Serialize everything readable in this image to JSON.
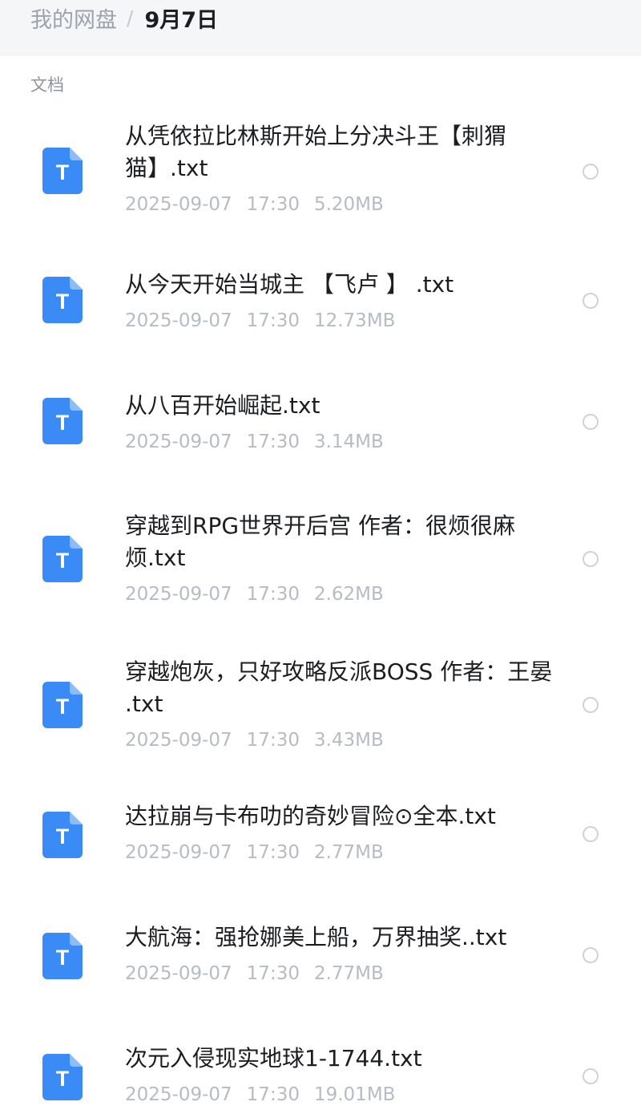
{
  "breadcrumb": {
    "root": "我的网盘",
    "separator": "/",
    "current": "9月7日"
  },
  "section": {
    "label": "文档"
  },
  "file_icon": {
    "glyph": "T",
    "color": "#3a8bf5",
    "icon_name": "text-file-icon"
  },
  "files": [
    {
      "name": "从凭依拉比林斯开始上分决斗王【刺猬猫】.txt",
      "date": "2025-09-07",
      "time": "17:30",
      "size": "5.20MB"
    },
    {
      "name": "从今天开始当城主 【飞卢 】 .txt",
      "date": "2025-09-07",
      "time": "17:30",
      "size": "12.73MB"
    },
    {
      "name": "从八百开始崛起.txt",
      "date": "2025-09-07",
      "time": "17:30",
      "size": "3.14MB"
    },
    {
      "name": "穿越到RPG世界开后宫 作者：很烦很麻烦.txt",
      "date": "2025-09-07",
      "time": "17:30",
      "size": "2.62MB"
    },
    {
      "name": "穿越炮灰，只好攻略反派BOSS 作者：王晏 .txt",
      "date": "2025-09-07",
      "time": "17:30",
      "size": "3.43MB"
    },
    {
      "name": "达拉崩与卡布叻的奇妙冒险⊙全本.txt",
      "date": "2025-09-07",
      "time": "17:30",
      "size": "2.77MB"
    },
    {
      "name": "大航海：强抢娜美上船，万界抽奖..txt",
      "date": "2025-09-07",
      "time": "17:30",
      "size": "2.77MB"
    },
    {
      "name": "次元入侵现实地球1-1744.txt",
      "date": "2025-09-07",
      "time": "17:30",
      "size": "19.01MB"
    }
  ]
}
